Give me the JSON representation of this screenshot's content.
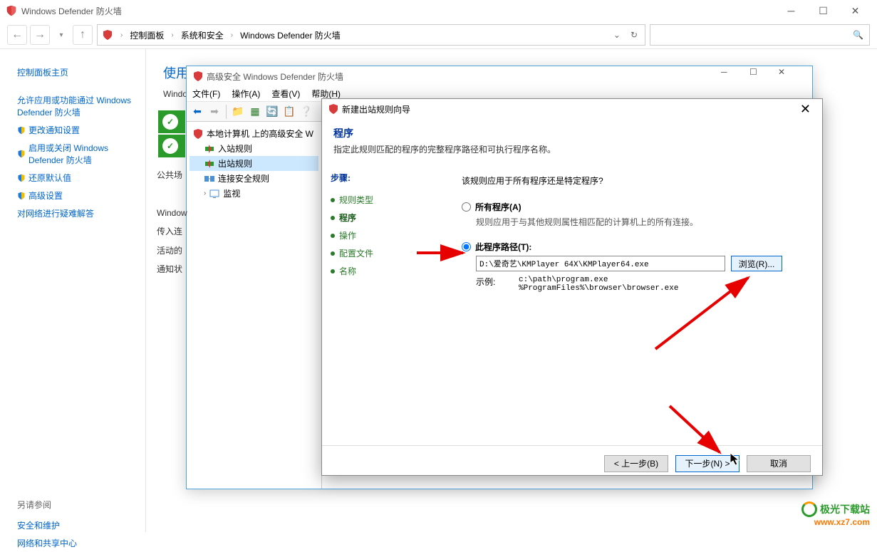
{
  "main_window": {
    "title": "Windows Defender 防火墙",
    "breadcrumbs": [
      "控制面板",
      "系统和安全",
      "Windows Defender 防火墙"
    ],
    "search_placeholder": ""
  },
  "sidebar": {
    "items": [
      "控制面板主页",
      "允许应用或功能通过 Windows Defender 防火墙",
      "更改通知设置",
      "启用或关闭 Windows Defender 防火墙",
      "还原默认值",
      "高级设置",
      "对网络进行疑难解答"
    ],
    "see_also_title": "另请参阅",
    "see_also": [
      "安全和维护",
      "网络和共享中心"
    ]
  },
  "content": {
    "heading": "使用 Windows Defender 防火墙来帮助保护你的电脑",
    "subheading_prefix": "Window"
  },
  "adv_window": {
    "title": "高级安全 Windows Defender 防火墙",
    "menubar": [
      "文件(F)",
      "操作(A)",
      "查看(V)",
      "帮助(H)"
    ],
    "tree_root": "本地计算机 上的高级安全 W",
    "tree_items": [
      "入站规则",
      "出站规则",
      "连接安全规则",
      "监视"
    ],
    "selected_tree_index": 1,
    "left_labels": [
      "公共场",
      "Window",
      "传入连",
      "活动的",
      "通知状"
    ]
  },
  "wizard": {
    "title": "新建出站规则向导",
    "heading": "程序",
    "subheading": "指定此规则匹配的程序的完整程序路径和可执行程序名称。",
    "steps_title": "步骤:",
    "steps": [
      "规则类型",
      "程序",
      "操作",
      "配置文件",
      "名称"
    ],
    "current_step": 1,
    "question": "该规则应用于所有程序还是特定程序?",
    "opt_all_label": "所有程序(A)",
    "opt_all_desc": "规则应用于与其他规则属性相匹配的计算机上的所有连接。",
    "opt_path_label": "此程序路径(T):",
    "selected_option": "path",
    "path_value": "D:\\爱奇艺\\KMPlayer 64X\\KMPlayer64.exe",
    "browse_label": "浏览(R)...",
    "example_label": "示例:",
    "example_text": "c:\\path\\program.exe\n%ProgramFiles%\\browser\\browser.exe",
    "btn_back": "< 上一步(B)",
    "btn_next": "下一步(N) >",
    "btn_cancel": "取消"
  },
  "watermark": {
    "name": "极光下载站",
    "url": "www.xz7.com"
  }
}
